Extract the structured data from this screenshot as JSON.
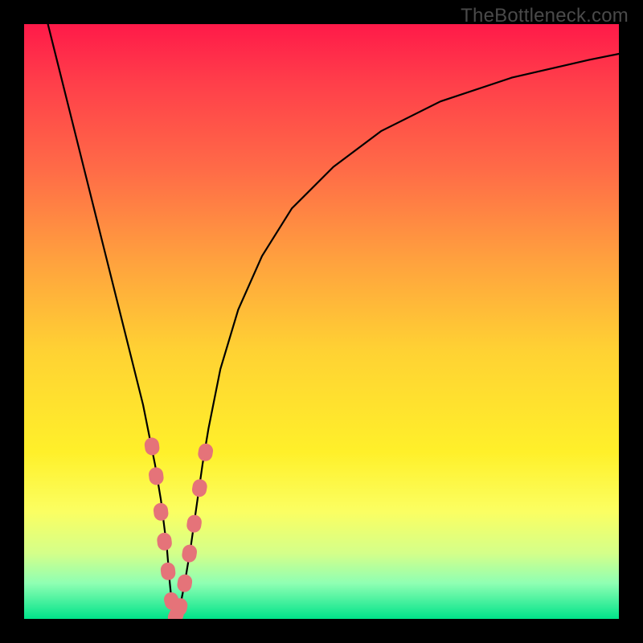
{
  "watermark": "TheBottleneck.com",
  "chart_data": {
    "type": "line",
    "title": "",
    "xlabel": "",
    "ylabel": "",
    "xlim": [
      0,
      100
    ],
    "ylim": [
      0,
      100
    ],
    "background_gradient": {
      "direction": "top-to-bottom",
      "stops": [
        {
          "pos": 0,
          "color": "#ff1a49"
        },
        {
          "pos": 25,
          "color": "#ff6d47"
        },
        {
          "pos": 55,
          "color": "#ffd233"
        },
        {
          "pos": 82,
          "color": "#fbff62"
        },
        {
          "pos": 100,
          "color": "#00e38a"
        }
      ]
    },
    "series": [
      {
        "name": "bottleneck-curve",
        "x": [
          4,
          6,
          8,
          10,
          12,
          14,
          16,
          18,
          20,
          22,
          23,
          24,
          24.5,
          25,
          25.5,
          26,
          27,
          28,
          29,
          30,
          31,
          33,
          36,
          40,
          45,
          52,
          60,
          70,
          82,
          95,
          100
        ],
        "y": [
          100,
          92,
          84,
          76,
          68,
          60,
          52,
          44,
          36,
          26,
          20,
          12,
          6,
          1,
          0,
          1,
          6,
          12,
          19,
          26,
          32,
          42,
          52,
          61,
          69,
          76,
          82,
          87,
          91,
          94,
          95
        ]
      }
    ],
    "markers": {
      "name": "highlight-beads",
      "color": "#e57379",
      "radius_approx": 1.3,
      "points": [
        {
          "x": 21.5,
          "y": 29
        },
        {
          "x": 22.2,
          "y": 24
        },
        {
          "x": 23.0,
          "y": 18
        },
        {
          "x": 23.6,
          "y": 13
        },
        {
          "x": 24.2,
          "y": 8
        },
        {
          "x": 24.8,
          "y": 3
        },
        {
          "x": 25.5,
          "y": 0.5
        },
        {
          "x": 26.2,
          "y": 2
        },
        {
          "x": 27.0,
          "y": 6
        },
        {
          "x": 27.8,
          "y": 11
        },
        {
          "x": 28.6,
          "y": 16
        },
        {
          "x": 29.5,
          "y": 22
        },
        {
          "x": 30.5,
          "y": 28
        }
      ]
    }
  }
}
